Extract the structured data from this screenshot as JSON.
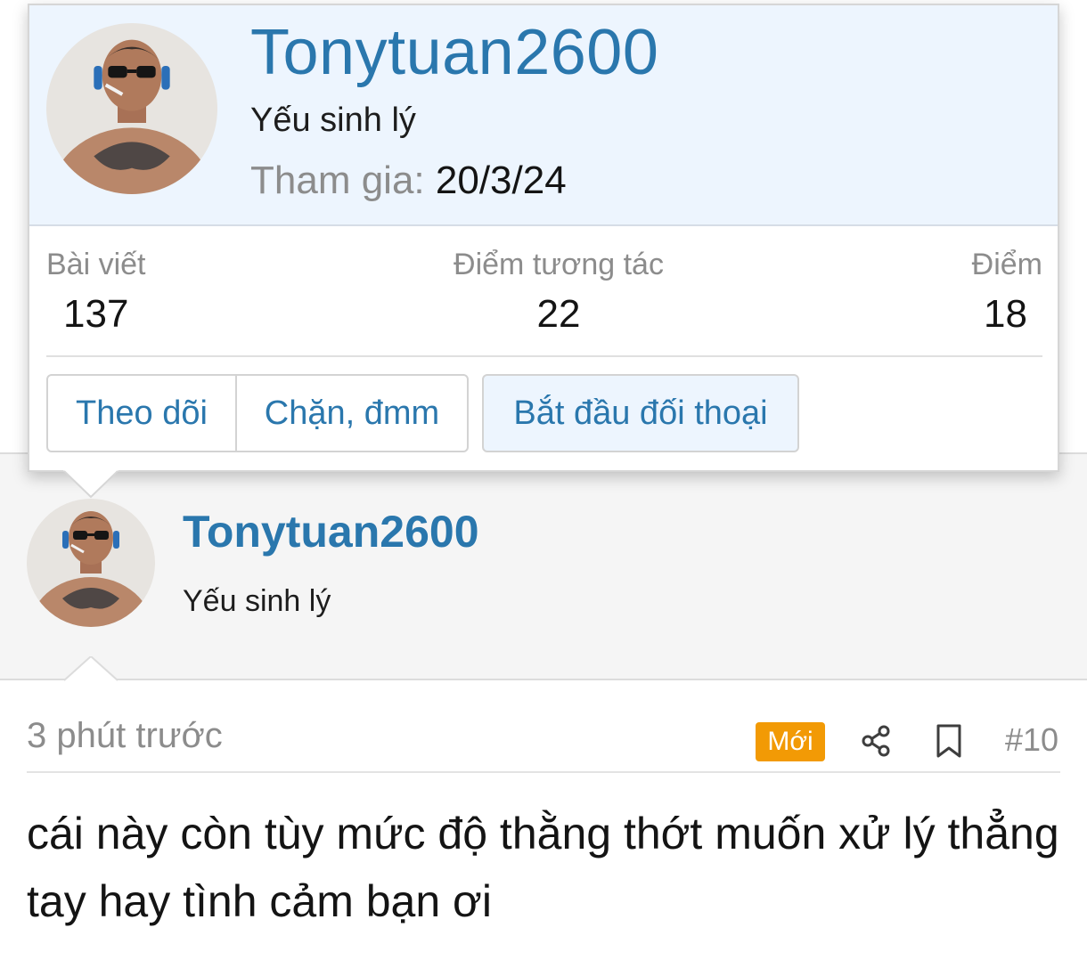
{
  "tooltip": {
    "username": "Tonytuan2600",
    "user_title": "Yếu sinh lý",
    "joined_label": "Tham gia:",
    "joined_value": "20/3/24",
    "stats": [
      {
        "label": "Bài viết",
        "value": "137"
      },
      {
        "label": "Điểm tương tác",
        "value": "22"
      },
      {
        "label": "Điểm",
        "value": "18"
      }
    ],
    "buttons": {
      "follow": "Theo dõi",
      "block": "Chặn, đmm",
      "start_conversation": "Bắt đầu đối thoại"
    }
  },
  "post": {
    "username": "Tonytuan2600",
    "user_title": "Yếu sinh lý",
    "time": "3 phút trước",
    "badge_new": "Mới",
    "post_number": "#10",
    "body": "cái này còn tùy mức độ thằng thớt muốn xử lý thẳng tay hay tình cảm bạn ơi"
  },
  "colors": {
    "link_blue": "#2a77ad",
    "header_bg": "#edf5fe",
    "badge_orange": "#f29a05",
    "muted_text": "#8c8c8c"
  },
  "icons": [
    "share-icon",
    "bookmark-icon"
  ]
}
